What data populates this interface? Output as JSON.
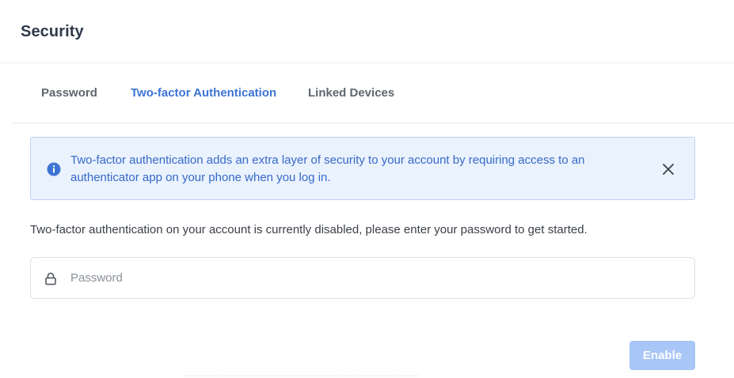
{
  "header": {
    "title": "Security"
  },
  "tabs": [
    {
      "label": "Password",
      "active": false
    },
    {
      "label": "Two-factor Authentication",
      "active": true
    },
    {
      "label": "Linked Devices",
      "active": false
    }
  ],
  "alert": {
    "icon": "info-icon",
    "message": "Two-factor authentication adds an extra layer of security to your account by requiring access to an authenticator app on your phone when you log in.",
    "close_icon": "close-icon"
  },
  "main": {
    "description": "Two-factor authentication on your account is currently disabled, please enter your password to get started.",
    "password_field": {
      "icon": "lock-icon",
      "placeholder": "Password",
      "value": ""
    },
    "enable_label": "Enable"
  },
  "colors": {
    "accent": "#3d74d4",
    "alert_background": "#eaf2fd",
    "alert_border": "#bcd2f3",
    "button_disabled": "#a8c6f6"
  }
}
